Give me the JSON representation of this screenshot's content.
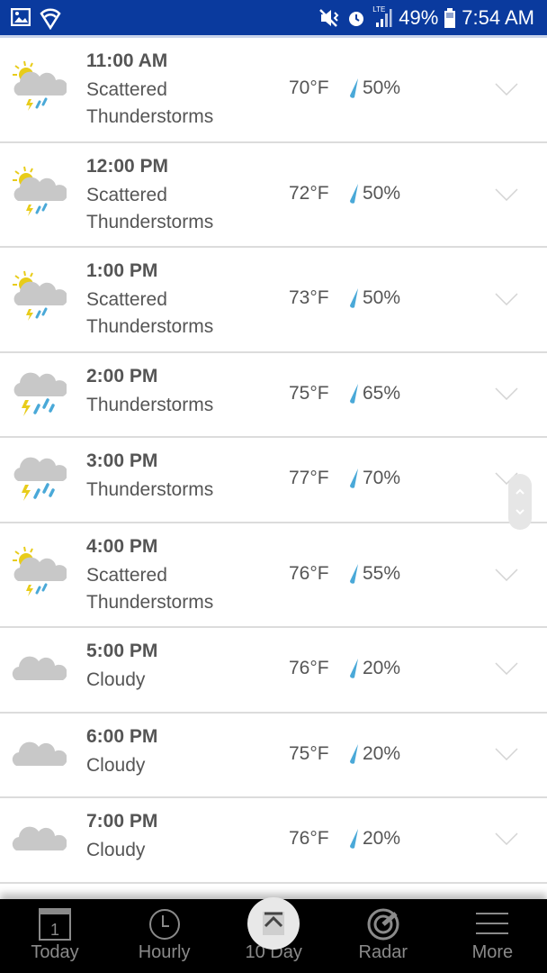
{
  "status_bar": {
    "battery": "49%",
    "time": "7:54 AM",
    "lte": "LTE"
  },
  "colors": {
    "status_bar": "#0a3a9e",
    "drop": "#4aa9d8",
    "text": "#555555"
  },
  "hours": [
    {
      "time": "11:00 AM",
      "condition": "Scattered Thunderstorms",
      "temp": "70°F",
      "precip": "50%",
      "icon": "scattered-thunderstorms-icon"
    },
    {
      "time": "12:00 PM",
      "condition": "Scattered Thunderstorms",
      "temp": "72°F",
      "precip": "50%",
      "icon": "scattered-thunderstorms-icon"
    },
    {
      "time": "1:00 PM",
      "condition": "Scattered Thunderstorms",
      "temp": "73°F",
      "precip": "50%",
      "icon": "scattered-thunderstorms-icon"
    },
    {
      "time": "2:00 PM",
      "condition": "Thunderstorms",
      "temp": "75°F",
      "precip": "65%",
      "icon": "thunderstorms-icon"
    },
    {
      "time": "3:00 PM",
      "condition": "Thunderstorms",
      "temp": "77°F",
      "precip": "70%",
      "icon": "thunderstorms-icon"
    },
    {
      "time": "4:00 PM",
      "condition": "Scattered Thunderstorms",
      "temp": "76°F",
      "precip": "55%",
      "icon": "scattered-thunderstorms-icon"
    },
    {
      "time": "5:00 PM",
      "condition": "Cloudy",
      "temp": "76°F",
      "precip": "20%",
      "icon": "cloudy-icon"
    },
    {
      "time": "6:00 PM",
      "condition": "Cloudy",
      "temp": "75°F",
      "precip": "20%",
      "icon": "cloudy-icon"
    },
    {
      "time": "7:00 PM",
      "condition": "Cloudy",
      "temp": "76°F",
      "precip": "20%",
      "icon": "cloudy-icon"
    }
  ],
  "nav": [
    {
      "label": "Today",
      "icon": "calendar-icon",
      "day": "1"
    },
    {
      "label": "Hourly",
      "icon": "clock-icon"
    },
    {
      "label": "10 Day",
      "icon": "ten-day-icon"
    },
    {
      "label": "Radar",
      "icon": "radar-icon"
    },
    {
      "label": "More",
      "icon": "menu-icon"
    }
  ]
}
